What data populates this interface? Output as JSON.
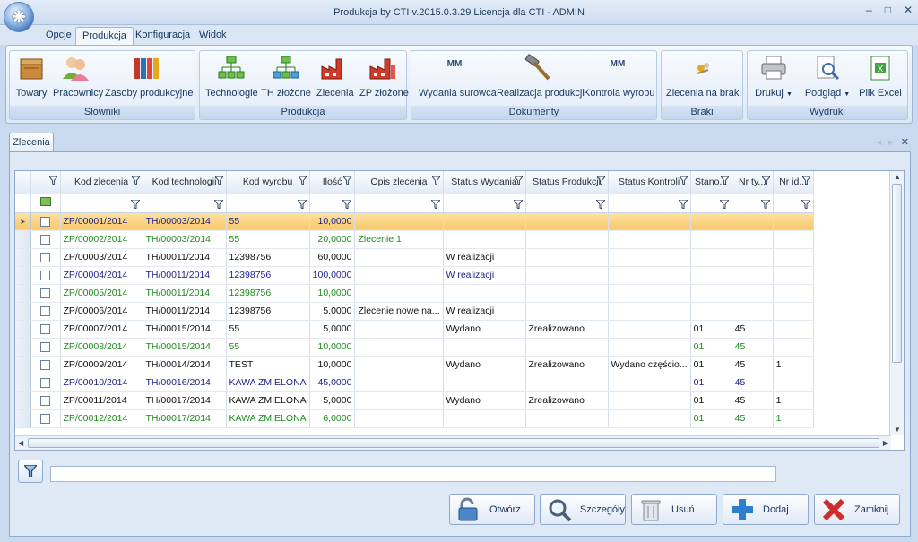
{
  "window": {
    "title": "Produkcja by CTI v.2015.0.3.29 Licencja dla CTI - ADMIN"
  },
  "menu": {
    "tabs": [
      {
        "label": "Opcje"
      },
      {
        "label": "Produkcja",
        "active": true
      },
      {
        "label": "Konfiguracja"
      },
      {
        "label": "Widok"
      }
    ]
  },
  "ribbon": {
    "groups": {
      "slowniki": "Słowniki",
      "produkcja": "Produkcja",
      "dokumenty": "Dokumenty",
      "braki": "Braki",
      "wydruki": "Wydruki"
    },
    "buttons": {
      "towary": "Towary",
      "pracownicy": "Pracownicy",
      "zasoby": "Zasoby produkcyjne",
      "technologie": "Technologie",
      "th_zlozone": "TH złożone",
      "zlecenia": "Zlecenia",
      "zp_zlozone": "ZP złożone",
      "wydania_surowca": "Wydania surowca",
      "realizacja": "Realizacja produkcji",
      "kontrola": "Kontrola wyrobu",
      "zlecenia_na_braki": "Zlecenia na braki",
      "drukuj": "Drukuj",
      "podglad": "Podgląd",
      "plik_excel": "Plik Excel"
    },
    "icon_text": {
      "mm1": "MM",
      "mm2": "MM"
    }
  },
  "doc_tab": {
    "label": "Zlecenia"
  },
  "grid": {
    "columns": [
      "Kod zlecenia",
      "Kod technologii",
      "Kod wyrobu",
      "Ilość",
      "Opis zlecenia",
      "Status Wydania",
      "Status Produkcji",
      "Status Kontroli",
      "Stano...",
      "Nr ty...",
      "Nr id..."
    ],
    "rows": [
      {
        "color": "blue",
        "selected": true,
        "cells": [
          "ZP/00001/2014",
          "TH/00003/2014",
          "55",
          "10,0000",
          "",
          "",
          "",
          "",
          "",
          "",
          ""
        ]
      },
      {
        "color": "green",
        "cells": [
          "ZP/00002/2014",
          "TH/00003/2014",
          "55",
          "20,0000",
          "Zlecenie 1",
          "",
          "",
          "",
          "",
          "",
          ""
        ]
      },
      {
        "color": "black",
        "cells": [
          "ZP/00003/2014",
          "TH/00011/2014",
          "12398756",
          "60,0000",
          "",
          "W realizacji",
          "",
          "",
          "",
          "",
          ""
        ]
      },
      {
        "color": "blue",
        "cells": [
          "ZP/00004/2014",
          "TH/00011/2014",
          "12398756",
          "100,0000",
          "",
          "W realizacji",
          "",
          "",
          "",
          "",
          ""
        ]
      },
      {
        "color": "green",
        "cells": [
          "ZP/00005/2014",
          "TH/00011/2014",
          "12398756",
          "10,0000",
          "",
          "",
          "",
          "",
          "",
          "",
          ""
        ]
      },
      {
        "color": "black",
        "cells": [
          "ZP/00006/2014",
          "TH/00011/2014",
          "12398756",
          "5,0000",
          "Zlecenie nowe na...",
          "W realizacji",
          "",
          "",
          "",
          "",
          ""
        ]
      },
      {
        "color": "black",
        "cells": [
          "ZP/00007/2014",
          "TH/00015/2014",
          "55",
          "5,0000",
          "",
          "Wydano",
          "Zrealizowano",
          "",
          "01",
          "45",
          ""
        ]
      },
      {
        "color": "green",
        "cells": [
          "ZP/00008/2014",
          "TH/00015/2014",
          "55",
          "10,0000",
          "",
          "",
          "",
          "",
          "01",
          "45",
          ""
        ]
      },
      {
        "color": "black",
        "cells": [
          "ZP/00009/2014",
          "TH/00014/2014",
          "TEST",
          "10,0000",
          "",
          "Wydano",
          "Zrealizowano",
          "Wydano częścio...",
          "01",
          "45",
          "1"
        ]
      },
      {
        "color": "blue",
        "cells": [
          "ZP/00010/2014",
          "TH/00016/2014",
          "KAWA ZMIELONA",
          "45,0000",
          "",
          "",
          "",
          "",
          "01",
          "45",
          ""
        ]
      },
      {
        "color": "black",
        "cells": [
          "ZP/00011/2014",
          "TH/00017/2014",
          "KAWA ZMIELONA",
          "5,0000",
          "",
          "Wydano",
          "Zrealizowano",
          "",
          "01",
          "45",
          "1"
        ]
      },
      {
        "color": "green",
        "cells": [
          "ZP/00012/2014",
          "TH/00017/2014",
          "KAWA ZMIELONA",
          "6,0000",
          "",
          "",
          "",
          "",
          "01",
          "45",
          "1"
        ]
      }
    ]
  },
  "bottom": {
    "search_value": "",
    "buttons": {
      "otworz": "Otwórz",
      "szczegoly": "Szczegóły",
      "usun": "Usuń",
      "dodaj": "Dodaj",
      "zamknij": "Zamknij"
    }
  }
}
